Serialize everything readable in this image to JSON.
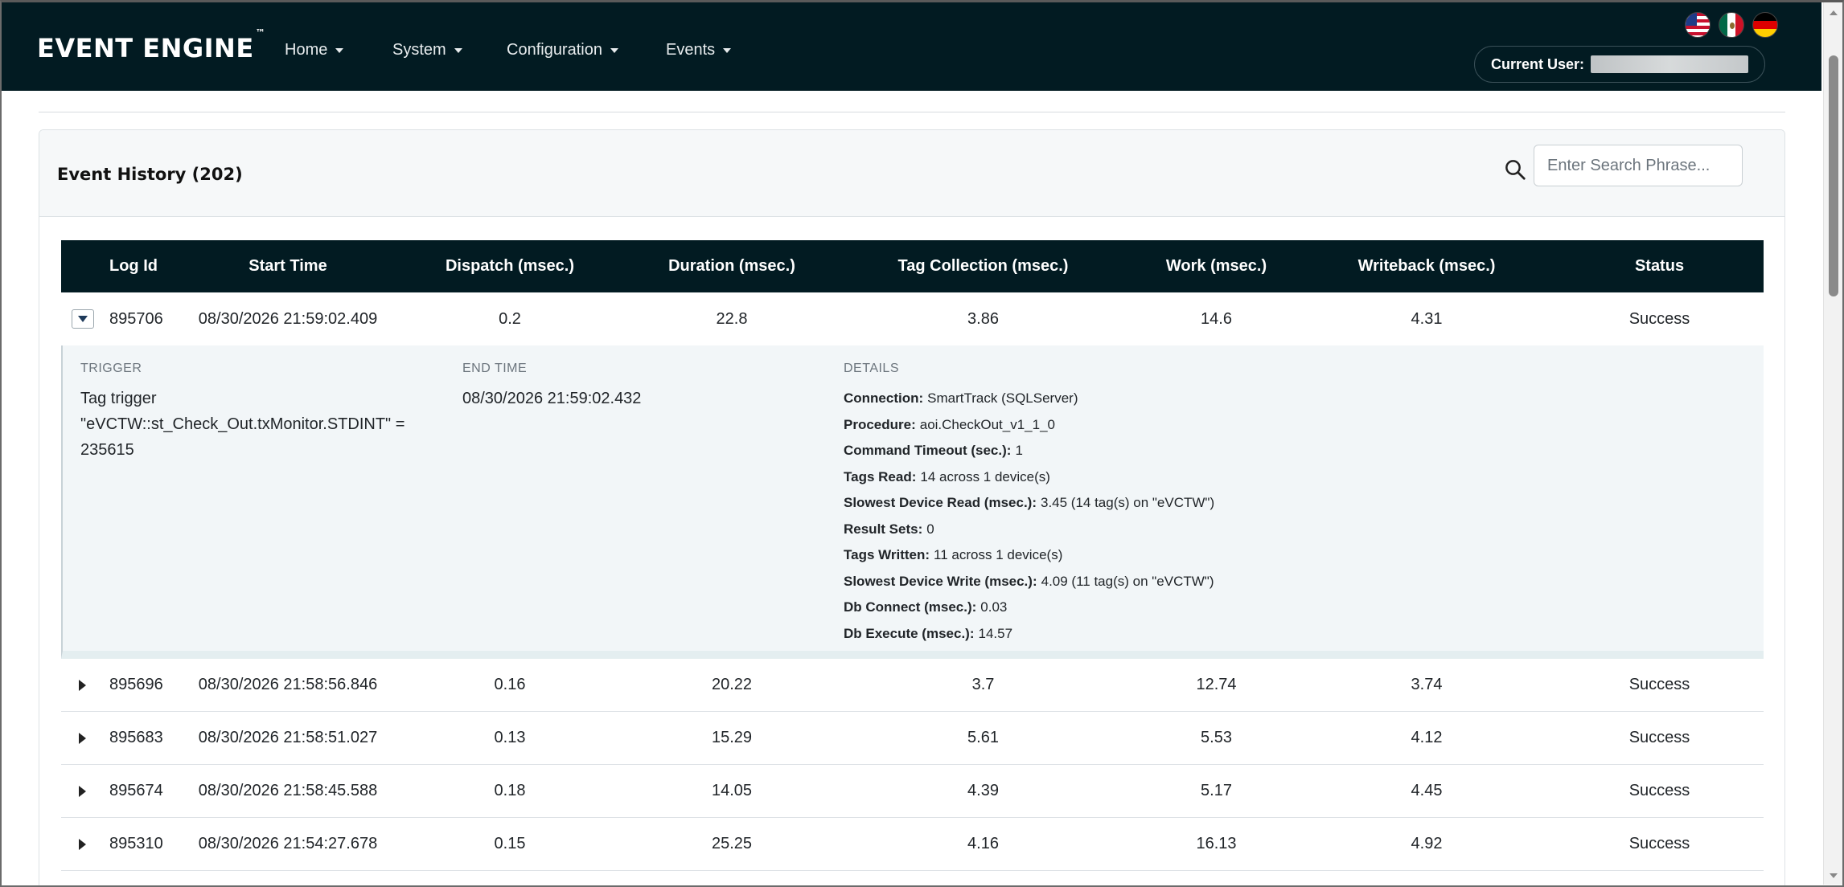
{
  "app": {
    "brand": "EVENT ENGINE",
    "brand_mark": "™",
    "nav": [
      {
        "label": "Home"
      },
      {
        "label": "System"
      },
      {
        "label": "Configuration"
      },
      {
        "label": "Events"
      }
    ],
    "current_user_label": "Current User:",
    "flags": [
      "us-flag-icon",
      "mx-flag-icon",
      "de-flag-icon"
    ]
  },
  "card": {
    "title": "Event History (202)",
    "search_placeholder": "Enter Search Phrase..."
  },
  "table": {
    "columns": [
      "Log Id",
      "Start Time",
      "Dispatch (msec.)",
      "Duration (msec.)",
      "Tag Collection (msec.)",
      "Work (msec.)",
      "Writeback (msec.)",
      "Status"
    ],
    "rows": [
      {
        "log_id": "895706",
        "start": "08/30/2026 21:59:02.409",
        "dispatch": "0.2",
        "duration": "22.8",
        "tag": "3.86",
        "work": "14.6",
        "writeback": "4.31",
        "status": "Success"
      },
      {
        "log_id": "895696",
        "start": "08/30/2026 21:58:56.846",
        "dispatch": "0.16",
        "duration": "20.22",
        "tag": "3.7",
        "work": "12.74",
        "writeback": "3.74",
        "status": "Success"
      },
      {
        "log_id": "895683",
        "start": "08/30/2026 21:58:51.027",
        "dispatch": "0.13",
        "duration": "15.29",
        "tag": "5.61",
        "work": "5.53",
        "writeback": "4.12",
        "status": "Success"
      },
      {
        "log_id": "895674",
        "start": "08/30/2026 21:58:45.588",
        "dispatch": "0.18",
        "duration": "14.05",
        "tag": "4.39",
        "work": "5.17",
        "writeback": "4.45",
        "status": "Success"
      },
      {
        "log_id": "895310",
        "start": "08/30/2026 21:54:27.678",
        "dispatch": "0.15",
        "duration": "25.25",
        "tag": "4.16",
        "work": "16.13",
        "writeback": "4.92",
        "status": "Success"
      }
    ]
  },
  "expanded": {
    "trigger_label": "TRIGGER",
    "trigger_lines": [
      "Tag trigger",
      "\"eVCTW::st_Check_Out.txMonitor.STDINT\" =",
      "235615"
    ],
    "end_time_label": "END TIME",
    "end_time": "08/30/2026 21:59:02.432",
    "details_label": "DETAILS",
    "details": [
      {
        "k": "Connection:",
        "v": "SmartTrack (SQLServer)"
      },
      {
        "k": "Procedure:",
        "v": "aoi.CheckOut_v1_1_0"
      },
      {
        "k": "Command Timeout (sec.):",
        "v": "1"
      },
      {
        "k": "Tags Read:",
        "v": "14 across 1 device(s)"
      },
      {
        "k": "Slowest Device Read (msec.):",
        "v": "3.45 (14 tag(s) on \"eVCTW\")"
      },
      {
        "k": "Result Sets:",
        "v": "0"
      },
      {
        "k": "Tags Written:",
        "v": "11 across 1 device(s)"
      },
      {
        "k": "Slowest Device Write (msec.):",
        "v": "4.09 (11 tag(s) on \"eVCTW\")"
      },
      {
        "k": "Db Connect (msec.):",
        "v": "0.03"
      },
      {
        "k": "Db Execute (msec.):",
        "v": "14.57"
      }
    ]
  }
}
